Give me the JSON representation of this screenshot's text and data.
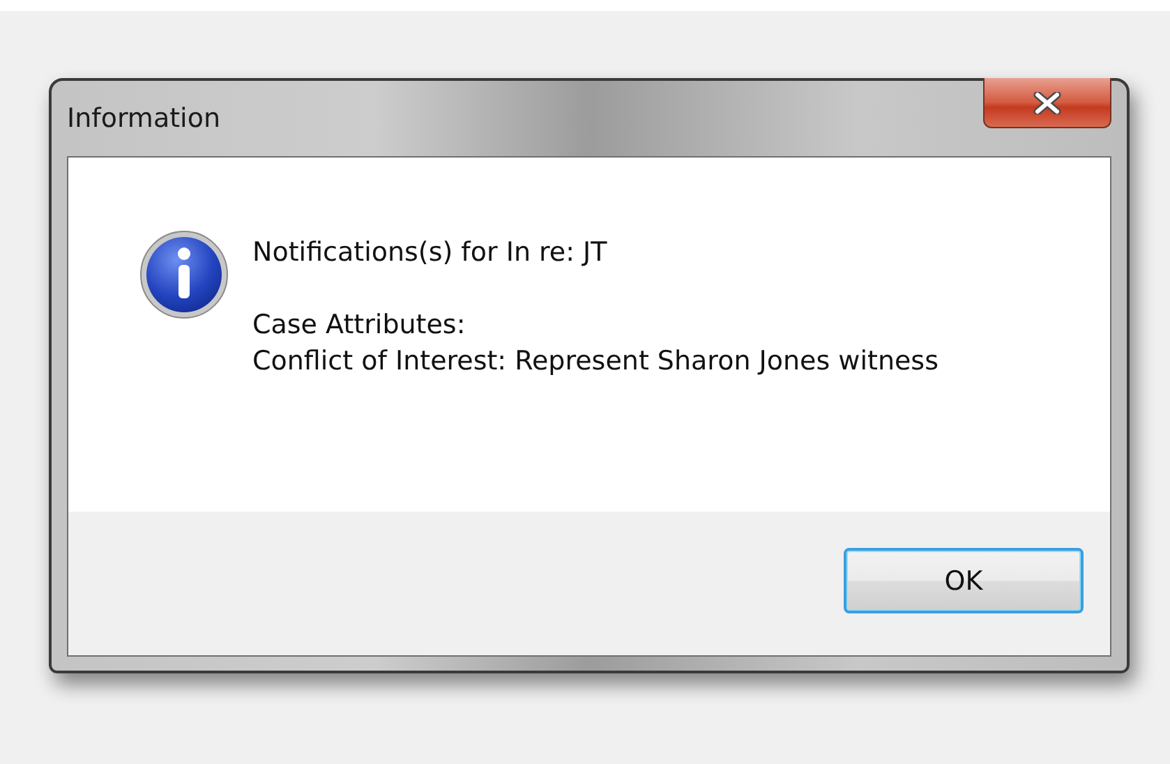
{
  "window": {
    "title": "Information"
  },
  "message": {
    "lines": [
      "Notifications(s) for In re: JT",
      "Case Attributes:",
      "Conflict of Interest: Represent Sharon Jones witness"
    ]
  },
  "buttons": [
    {
      "label": "OK",
      "default": true
    }
  ]
}
